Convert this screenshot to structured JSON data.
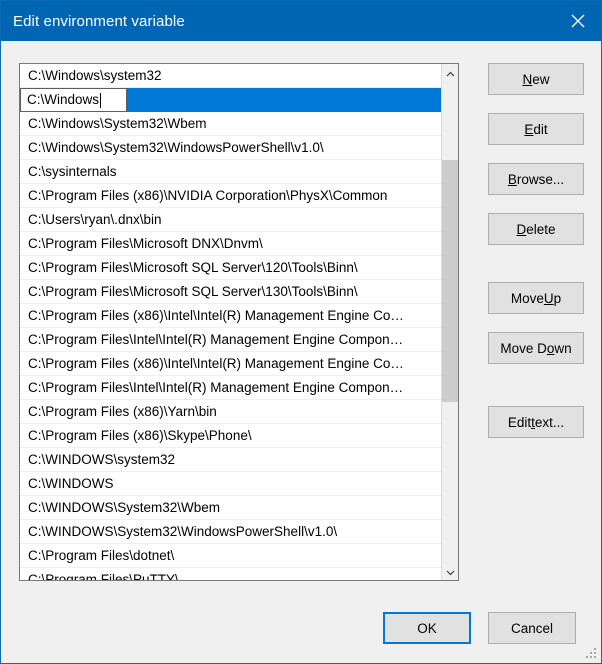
{
  "window": {
    "title": "Edit environment variable",
    "close_icon": "close-icon",
    "accent_color": "#0066b4",
    "selection_color": "#0078d7",
    "background_color": "#f0f0f0"
  },
  "list": {
    "editing_row_index": 1,
    "edit_value": "C:\\Windows",
    "items": [
      "C:\\Windows\\system32",
      "C:\\Windows",
      "C:\\Windows\\System32\\Wbem",
      "C:\\Windows\\System32\\WindowsPowerShell\\v1.0\\",
      "C:\\sysinternals",
      "C:\\Program Files (x86)\\NVIDIA Corporation\\PhysX\\Common",
      "C:\\Users\\ryan\\.dnx\\bin",
      "C:\\Program Files\\Microsoft DNX\\Dnvm\\",
      "C:\\Program Files\\Microsoft SQL Server\\120\\Tools\\Binn\\",
      "C:\\Program Files\\Microsoft SQL Server\\130\\Tools\\Binn\\",
      "C:\\Program Files (x86)\\Intel\\Intel(R) Management Engine Co…",
      "C:\\Program Files\\Intel\\Intel(R) Management Engine Compon…",
      "C:\\Program Files (x86)\\Intel\\Intel(R) Management Engine Co…",
      "C:\\Program Files\\Intel\\Intel(R) Management Engine Compon…",
      "C:\\Program Files (x86)\\Yarn\\bin",
      "C:\\Program Files (x86)\\Skype\\Phone\\",
      "C:\\WINDOWS\\system32",
      "C:\\WINDOWS",
      "C:\\WINDOWS\\System32\\Wbem",
      "C:\\WINDOWS\\System32\\WindowsPowerShell\\v1.0\\",
      "C:\\Program Files\\dotnet\\",
      "C:\\Program Files\\PuTTY\\"
    ],
    "scrollbar": {
      "up_arrow_icon": "chevron-up-icon",
      "down_arrow_icon": "chevron-down-icon"
    }
  },
  "side_buttons": {
    "new": {
      "prefix": "",
      "accel": "N",
      "suffix": "ew"
    },
    "edit": {
      "prefix": "",
      "accel": "E",
      "suffix": "dit"
    },
    "browse": {
      "prefix": "",
      "accel": "B",
      "suffix": "rowse..."
    },
    "delete": {
      "prefix": "",
      "accel": "D",
      "suffix": "elete"
    },
    "move_up": {
      "prefix": "Move ",
      "accel": "U",
      "suffix": "p"
    },
    "move_down": {
      "prefix": "Move D",
      "accel": "o",
      "suffix": "wn"
    },
    "edit_text": {
      "prefix": "Edit ",
      "accel": "t",
      "suffix": "ext..."
    }
  },
  "footer": {
    "ok_label": "OK",
    "cancel_label": "Cancel"
  }
}
